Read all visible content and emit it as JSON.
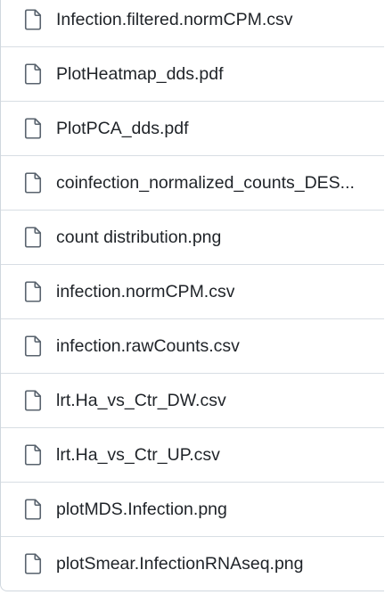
{
  "files": [
    {
      "name": "Infection.filtered.normCPM.csv",
      "icon": "file-icon"
    },
    {
      "name": "PlotHeatmap_dds.pdf",
      "icon": "file-icon"
    },
    {
      "name": "PlotPCA_dds.pdf",
      "icon": "file-icon"
    },
    {
      "name": "coinfection_normalized_counts_DES...",
      "icon": "file-icon"
    },
    {
      "name": "count distribution.png",
      "icon": "file-icon"
    },
    {
      "name": "infection.normCPM.csv",
      "icon": "file-icon"
    },
    {
      "name": "infection.rawCounts.csv",
      "icon": "file-icon"
    },
    {
      "name": "lrt.Ha_vs_Ctr_DW.csv",
      "icon": "file-icon"
    },
    {
      "name": "lrt.Ha_vs_Ctr_UP.csv",
      "icon": "file-icon"
    },
    {
      "name": "plotMDS.Infection.png",
      "icon": "file-icon"
    },
    {
      "name": "plotSmear.InfectionRNAseq.png",
      "icon": "file-icon"
    }
  ],
  "colors": {
    "text": "#1f2328",
    "icon": "#59636e",
    "border": "#d0d7de"
  }
}
